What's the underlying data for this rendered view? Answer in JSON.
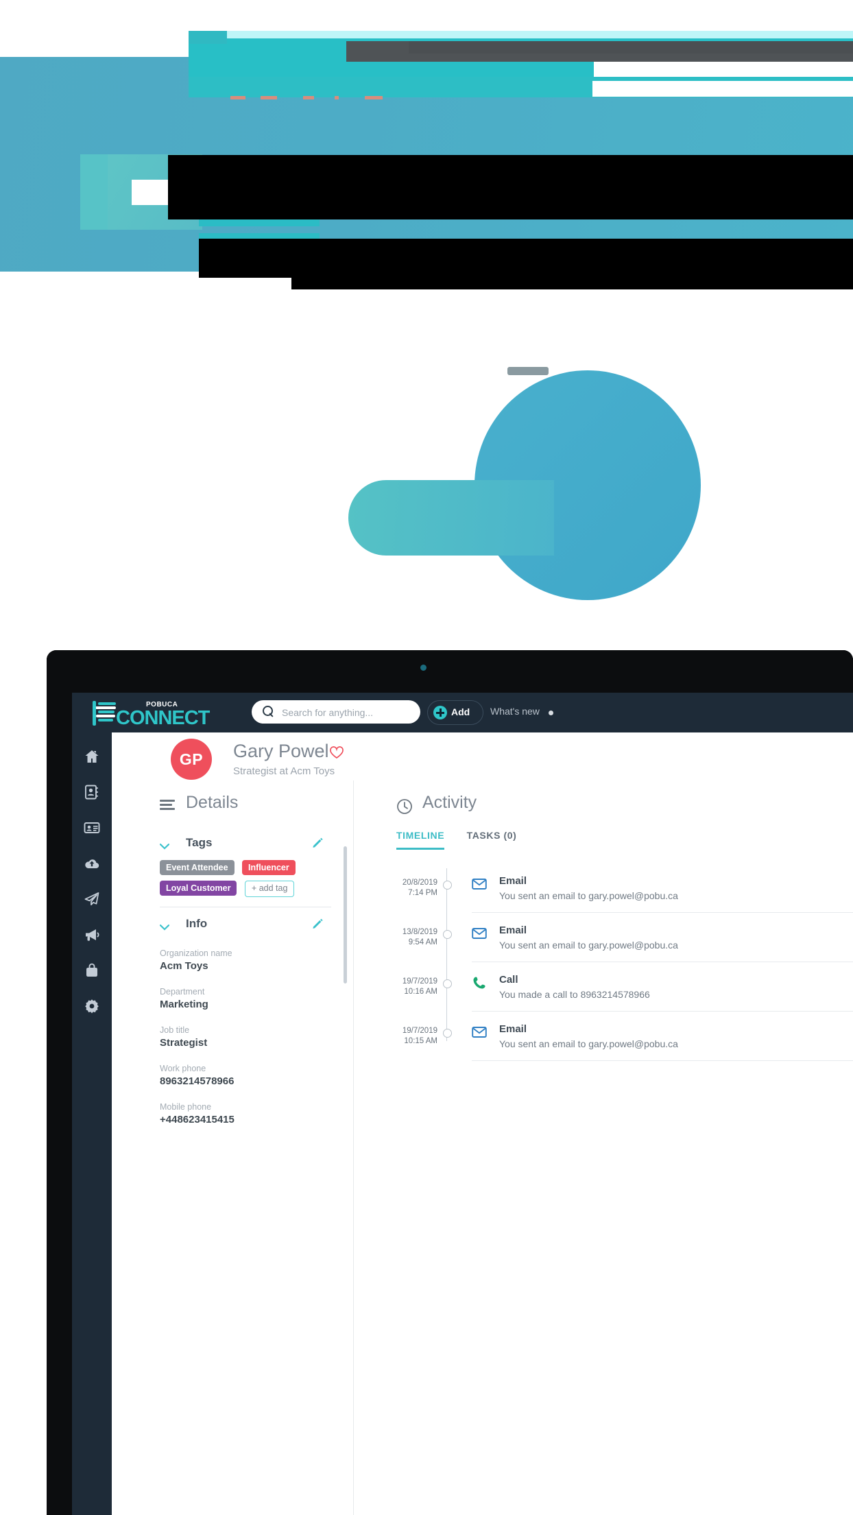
{
  "hero": {
    "decor_note": "redacted-banner",
    "colors": {
      "band": "#4dacc6",
      "teal": "#28bfc6",
      "pale_teal": "#bff6f8",
      "dark": "#4f5356",
      "redaction": "#000000"
    }
  },
  "app": {
    "brand": {
      "superscript": "POBUCA",
      "wordmark": "CONNECT",
      "accent": "#2fc6c9"
    },
    "search": {
      "placeholder": "Search for anything...",
      "value": ""
    },
    "add_button": "Add",
    "whats_new": "What's new",
    "sidebar": [
      {
        "name": "home",
        "label": "Home"
      },
      {
        "name": "contacts",
        "label": "Contacts"
      },
      {
        "name": "cards",
        "label": "Business cards"
      },
      {
        "name": "upload",
        "label": "Upload"
      },
      {
        "name": "send",
        "label": "Send"
      },
      {
        "name": "campaigns",
        "label": "Campaigns"
      },
      {
        "name": "deals",
        "label": "Deals"
      },
      {
        "name": "settings",
        "label": "Settings"
      }
    ],
    "profile": {
      "initials": "GP",
      "name": "Gary Powel",
      "subtitle": "Strategist at Acm Toys",
      "avatar_color": "#ef4f5c",
      "favorite_icon": "heart-outline-icon"
    },
    "details": {
      "title": "Details",
      "tags_section": {
        "label": "Tags",
        "tags": [
          {
            "text": "Event Attendee",
            "color": "#8b9199"
          },
          {
            "text": "Influencer",
            "color": "#ef4f5c"
          },
          {
            "text": "Loyal Customer",
            "color": "#8245a3"
          }
        ],
        "add_tag": "+ add tag"
      },
      "info_section": {
        "label": "Info",
        "fields": [
          {
            "label": "Organization name",
            "value": "Acm Toys"
          },
          {
            "label": "Department",
            "value": "Marketing"
          },
          {
            "label": "Job title",
            "value": "Strategist"
          },
          {
            "label": "Work phone",
            "value": "8963214578966"
          },
          {
            "label": "Mobile phone",
            "value": "+448623415415"
          }
        ]
      }
    },
    "activity": {
      "title": "Activity",
      "tabs": [
        {
          "label": "TIMELINE",
          "active": true
        },
        {
          "label": "TASKS (0)",
          "active": false
        }
      ],
      "timeline": [
        {
          "date": "20/8/2019",
          "time": "7:14 PM",
          "type": "Email",
          "icon": "envelope-icon",
          "icon_color": "#2f7fc4",
          "description": "You sent an email to gary.powel@pobu.ca"
        },
        {
          "date": "13/8/2019",
          "time": "9:54 AM",
          "type": "Email",
          "icon": "envelope-icon",
          "icon_color": "#2f7fc4",
          "description": "You sent an email to gary.powel@pobu.ca"
        },
        {
          "date": "19/7/2019",
          "time": "10:16 AM",
          "type": "Call",
          "icon": "phone-icon",
          "icon_color": "#1aa870",
          "description": "You made a call to 8963214578966"
        },
        {
          "date": "19/7/2019",
          "time": "10:15 AM",
          "type": "Email",
          "icon": "envelope-icon",
          "icon_color": "#2f7fc4",
          "description": "You sent an email to gary.powel@pobu.ca"
        }
      ]
    }
  }
}
